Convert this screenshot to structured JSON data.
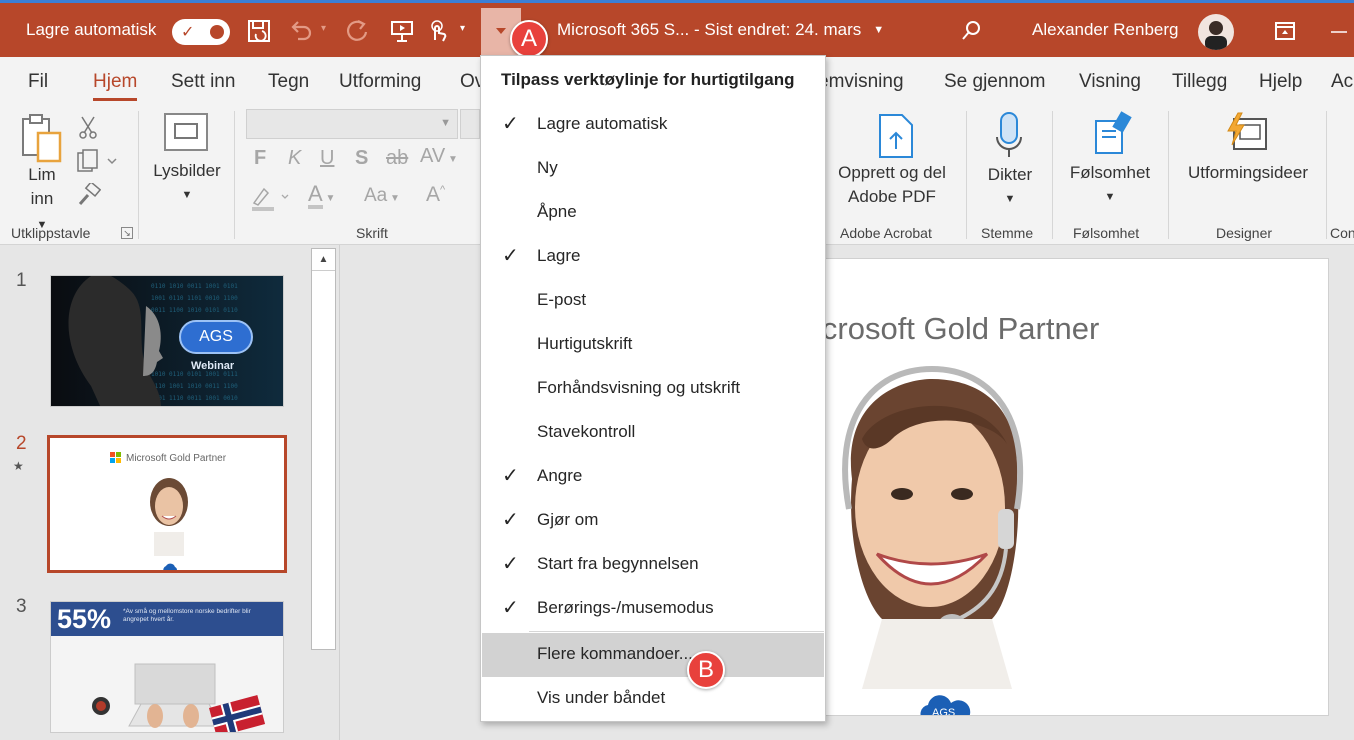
{
  "titlebar": {
    "autosave_label": "Lagre automatisk",
    "autosave_state": "✓",
    "doc_title": "Microsoft 365 S...  -  Sist endret: 24. mars",
    "user_name": "Alexander Renberg",
    "callout_a": "A",
    "bg_color": "#b7472a"
  },
  "tabs": [
    "Fil",
    "Hjem",
    "Sett inn",
    "Tegn",
    "Utforming",
    "Ov",
    "emvisning",
    "Se gjennom",
    "Visning",
    "Tillegg",
    "Hjelp",
    "Ac"
  ],
  "ribbon": {
    "paste_label_1": "Lim",
    "paste_label_2": "inn",
    "group_clipboard": "Utklippstavle",
    "slides_label": "Lysbilder",
    "group_font": "Skrift",
    "font_bold": "F",
    "font_italic": "K",
    "font_underline": "U",
    "font_shadow": "S",
    "font_strike": "ab",
    "font_spacing": "AV",
    "font_size_change": "Aa",
    "font_grow": "A",
    "font_color": "A",
    "pdf_label_1": "Opprett og del",
    "pdf_label_2": "Adobe PDF",
    "group_acrobat": "Adobe Acrobat",
    "dictate_label": "Dikter",
    "group_voice": "Stemme",
    "sensitivity_label": "Følsomhet",
    "group_sensitivity": "Følsomhet",
    "designer_label": "Utformingsideer",
    "group_designer": "Designer",
    "group_cut": "Con"
  },
  "slides": [
    {
      "number": "1",
      "cloud_text": "AGS",
      "sub_text": "Webinar"
    },
    {
      "number": "2",
      "title": "Microsoft Gold Partner"
    },
    {
      "number": "3",
      "big_text": "55%",
      "small_text": "*Av små og mellomstore norske bedrifter blir angrepet hvert år."
    }
  ],
  "main_slide": {
    "title": "icrosoft Gold Partner",
    "logo_text": "AGS"
  },
  "menu": {
    "header": "Tilpass verktøylinje for hurtigtilgang",
    "items": [
      {
        "label": "Lagre automatisk",
        "checked": true
      },
      {
        "label": "Ny",
        "checked": false
      },
      {
        "label": "Åpne",
        "checked": false
      },
      {
        "label": "Lagre",
        "checked": true
      },
      {
        "label": "E-post",
        "checked": false
      },
      {
        "label": "Hurtigutskrift",
        "checked": false
      },
      {
        "label": "Forhåndsvisning og utskrift",
        "checked": false
      },
      {
        "label": "Stavekontroll",
        "checked": false
      },
      {
        "label": "Angre",
        "checked": true
      },
      {
        "label": "Gjør om",
        "checked": true
      },
      {
        "label": "Start fra begynnelsen",
        "checked": true
      },
      {
        "label": "Berørings-/musemodus",
        "checked": true
      }
    ],
    "more_commands": "Flere kommandoer...",
    "show_below": "Vis under båndet",
    "callout_b": "B",
    "check_glyph": "✓"
  }
}
